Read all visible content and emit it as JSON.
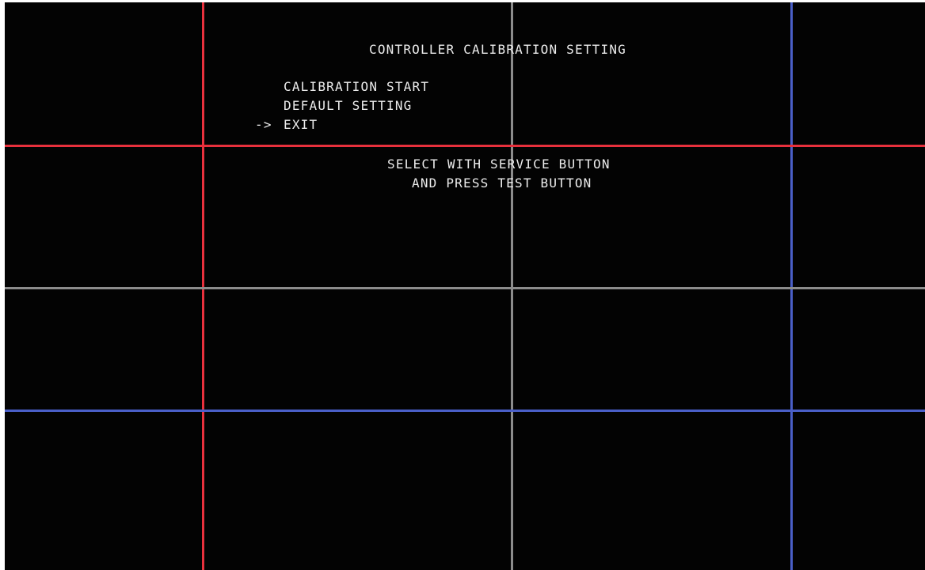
{
  "screen": {
    "title": "CONTROLLER CALIBRATION SETTING",
    "menu": {
      "items": [
        {
          "label": "CALIBRATION START",
          "cursor": ""
        },
        {
          "label": "DEFAULT SETTING",
          "cursor": ""
        },
        {
          "label": "EXIT",
          "cursor": "->"
        }
      ]
    },
    "instructions": {
      "line1": "SELECT WITH SERVICE BUTTON",
      "line2": "AND PRESS TEST BUTTON"
    }
  },
  "colors": {
    "background": "#030303",
    "text": "#ececec",
    "grid_red": "#e8303c",
    "grid_gray": "#8c8c8c",
    "grid_blue": "#4a5fc8"
  }
}
